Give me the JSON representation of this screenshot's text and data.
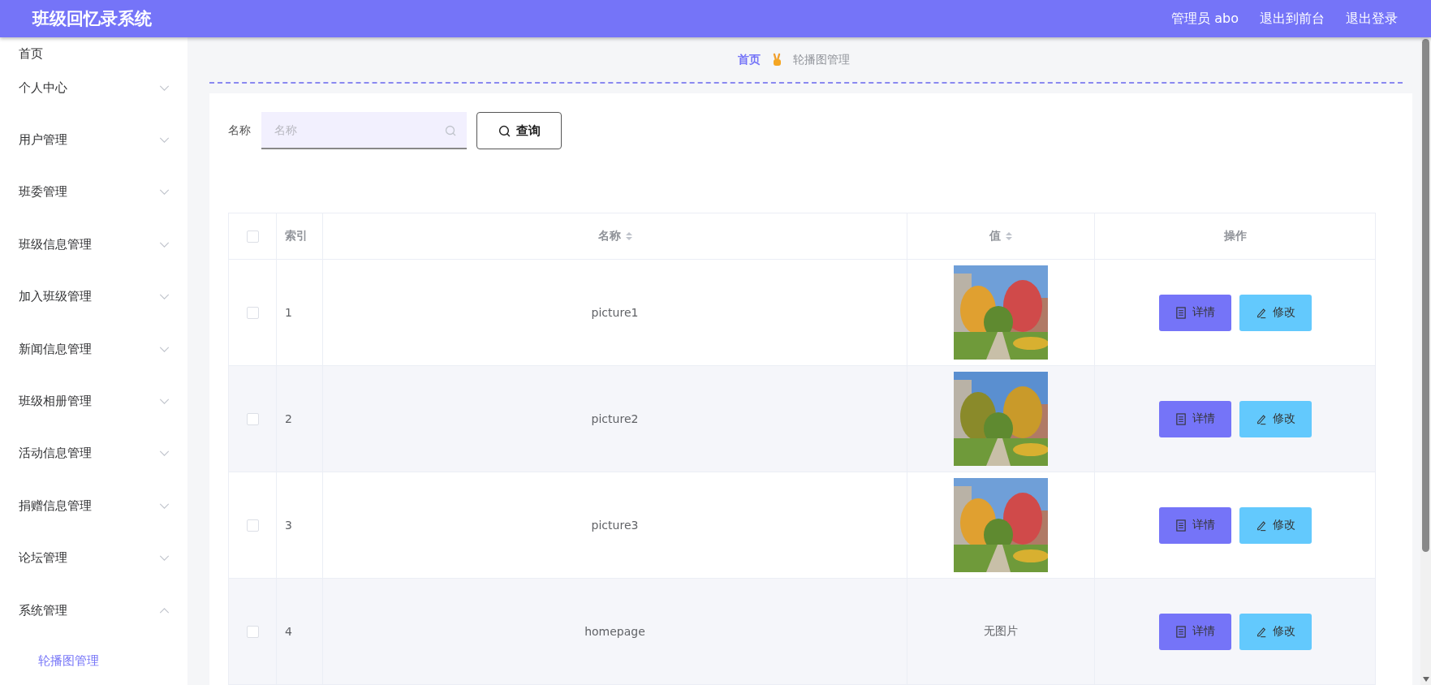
{
  "header": {
    "title": "班级回忆录系统",
    "links": [
      "管理员 abo",
      "退出到前台",
      "退出登录"
    ]
  },
  "sidebar": {
    "items": [
      {
        "label": "首页",
        "kind": "link"
      },
      {
        "label": "个人中心",
        "kind": "menu",
        "expanded": false
      },
      {
        "label": "用户管理",
        "kind": "menu",
        "expanded": false
      },
      {
        "label": "班委管理",
        "kind": "menu",
        "expanded": false
      },
      {
        "label": "班级信息管理",
        "kind": "menu",
        "expanded": false
      },
      {
        "label": "加入班级管理",
        "kind": "menu",
        "expanded": false
      },
      {
        "label": "新闻信息管理",
        "kind": "menu",
        "expanded": false
      },
      {
        "label": "班级相册管理",
        "kind": "menu",
        "expanded": false
      },
      {
        "label": "活动信息管理",
        "kind": "menu",
        "expanded": false
      },
      {
        "label": "捐赠信息管理",
        "kind": "menu",
        "expanded": false
      },
      {
        "label": "论坛管理",
        "kind": "menu",
        "expanded": false
      },
      {
        "label": "系统管理",
        "kind": "menu",
        "expanded": true,
        "children": [
          {
            "label": "轮播图管理",
            "selected": true
          }
        ]
      }
    ]
  },
  "breadcrumb": [
    "首页",
    "轮播图管理"
  ],
  "search": {
    "label": "名称",
    "placeholder": "名称",
    "button": "查询"
  },
  "table": {
    "all_checked": false,
    "columns": [
      {
        "label": "索引",
        "sortable": false
      },
      {
        "label": "名称",
        "sortable": true
      },
      {
        "label": "值",
        "sortable": true
      },
      {
        "label": "操作",
        "sortable": false
      }
    ],
    "rows": [
      {
        "checked": false,
        "index": "1",
        "name": "picture1",
        "value": {
          "kind": "picture"
        },
        "actions": [
          "详情",
          "修改"
        ]
      },
      {
        "checked": false,
        "index": "2",
        "name": "picture2",
        "value": {
          "kind": "picture"
        },
        "actions": [
          "详情",
          "修改"
        ]
      },
      {
        "checked": false,
        "index": "3",
        "name": "picture3",
        "value": {
          "kind": "picture"
        },
        "actions": [
          "详情",
          "修改"
        ]
      },
      {
        "checked": false,
        "index": "4",
        "name": "homepage",
        "value": {
          "kind": "text",
          "text": "无图片"
        },
        "actions": [
          "详情",
          "修改"
        ]
      }
    ]
  }
}
